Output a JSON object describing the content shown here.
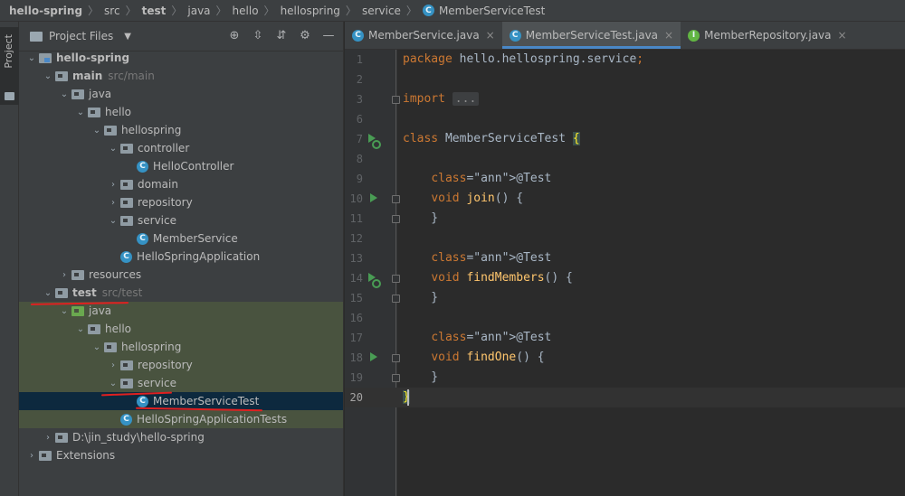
{
  "breadcrumb": {
    "items": [
      "hello-spring",
      "src",
      "test",
      "java",
      "hello",
      "hellospring",
      "service",
      "MemberServiceTest"
    ],
    "separator": "〉"
  },
  "tool_strip": {
    "project_label": "Project"
  },
  "project_panel": {
    "title": "Project Files",
    "toolbar_icons": [
      "locate-icon",
      "expand-all-icon",
      "collapse-all-icon",
      "settings-icon",
      "hide-icon"
    ],
    "tree": [
      {
        "label": "hello-spring",
        "depth": 0,
        "expanded": true,
        "icon": "module-folder-icon",
        "bold": true
      },
      {
        "label": "main",
        "hint": "src/main",
        "depth": 1,
        "expanded": true,
        "icon": "folder-icon",
        "bold": true
      },
      {
        "label": "java",
        "depth": 2,
        "expanded": true,
        "icon": "folder-icon"
      },
      {
        "label": "hello",
        "depth": 3,
        "expanded": true,
        "icon": "folder-icon"
      },
      {
        "label": "hellospring",
        "depth": 4,
        "expanded": true,
        "icon": "folder-icon"
      },
      {
        "label": "controller",
        "depth": 5,
        "expanded": true,
        "icon": "folder-icon"
      },
      {
        "label": "HelloController",
        "depth": 6,
        "icon": "class-icon"
      },
      {
        "label": "domain",
        "depth": 5,
        "expanded": false,
        "icon": "folder-icon"
      },
      {
        "label": "repository",
        "depth": 5,
        "expanded": false,
        "icon": "folder-icon"
      },
      {
        "label": "service",
        "depth": 5,
        "expanded": true,
        "icon": "folder-icon"
      },
      {
        "label": "MemberService",
        "depth": 6,
        "icon": "class-icon"
      },
      {
        "label": "HelloSpringApplication",
        "depth": 5,
        "icon": "spring-class-icon"
      },
      {
        "label": "resources",
        "depth": 2,
        "expanded": false,
        "icon": "folder-icon"
      },
      {
        "label": "test",
        "hint": "src/test",
        "depth": 1,
        "expanded": true,
        "icon": "folder-icon",
        "bold": true
      },
      {
        "label": "java",
        "depth": 2,
        "expanded": true,
        "icon": "test-folder-icon",
        "test": true
      },
      {
        "label": "hello",
        "depth": 3,
        "expanded": true,
        "icon": "folder-icon",
        "test": true
      },
      {
        "label": "hellospring",
        "depth": 4,
        "expanded": true,
        "icon": "folder-icon",
        "test": true
      },
      {
        "label": "repository",
        "depth": 5,
        "expanded": false,
        "icon": "folder-icon",
        "test": true
      },
      {
        "label": "service",
        "depth": 5,
        "expanded": true,
        "icon": "folder-icon",
        "test": true
      },
      {
        "label": "MemberServiceTest",
        "depth": 6,
        "icon": "class-icon",
        "selected": true
      },
      {
        "label": "HelloSpringApplicationTests",
        "depth": 5,
        "icon": "class-icon",
        "test": true
      },
      {
        "label": "D:\\jin_study\\hello-spring",
        "depth": 1,
        "expanded": false,
        "icon": "folder-icon"
      },
      {
        "label": "Extensions",
        "depth": 0,
        "expanded": false,
        "icon": "folder-icon"
      }
    ]
  },
  "tabs": [
    {
      "label": "MemberService.java",
      "icon": "class-icon",
      "active": false
    },
    {
      "label": "MemberServiceTest.java",
      "icon": "class-icon",
      "active": true
    },
    {
      "label": "MemberRepository.java",
      "icon": "interface-icon",
      "active": false
    }
  ],
  "editor": {
    "lines": [
      {
        "n": "1",
        "code": "package hello.hellospring.service;"
      },
      {
        "n": "2",
        "code": ""
      },
      {
        "n": "3",
        "code": "import ..."
      },
      {
        "n": "6",
        "code": ""
      },
      {
        "n": "7",
        "code": "class MemberServiceTest {",
        "gutter": "run-all"
      },
      {
        "n": "8",
        "code": ""
      },
      {
        "n": "9",
        "code": "    @Test"
      },
      {
        "n": "10",
        "code": "    void join() {",
        "gutter": "run"
      },
      {
        "n": "11",
        "code": "    }"
      },
      {
        "n": "12",
        "code": ""
      },
      {
        "n": "13",
        "code": "    @Test"
      },
      {
        "n": "14",
        "code": "    void findMembers() {",
        "gutter": "run-all"
      },
      {
        "n": "15",
        "code": "    }"
      },
      {
        "n": "16",
        "code": ""
      },
      {
        "n": "17",
        "code": "    @Test"
      },
      {
        "n": "18",
        "code": "    void findOne() {",
        "gutter": "run"
      },
      {
        "n": "19",
        "code": "    }"
      },
      {
        "n": "20",
        "code": "}",
        "current": true
      }
    ]
  },
  "colors": {
    "background": "#2b2b2b",
    "panel": "#3c3f41",
    "selection": "#0d293e",
    "test_highlight": "#49533f",
    "keyword": "#cc7832",
    "annotation": "#bbb529",
    "method": "#ffc66d",
    "red_underline": "#e02020"
  }
}
